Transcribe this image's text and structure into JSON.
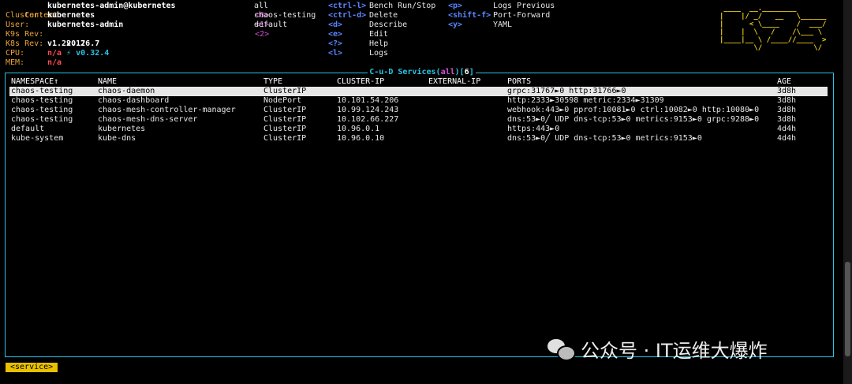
{
  "info": {
    "context_label": "Context:",
    "context_value": "kubernetes-admin@kubernetes",
    "cluster_label": "Cluster:",
    "cluster_value": "kubernetes",
    "user_label": "User:",
    "user_value": "kubernetes-admin",
    "k9s_rev_label": "K9s Rev:",
    "k9s_rev_value": "v0.26.7",
    "k9s_rev_new": "⚡ v0.32.4",
    "k8s_rev_label": "K8s Rev:",
    "k8s_rev_value": "v1.22.17",
    "cpu_label": "CPU:",
    "cpu_value": "n/a",
    "mem_label": "MEM:",
    "mem_value": "n/a"
  },
  "namespaces": [
    {
      "key": "<0>",
      "name": "all"
    },
    {
      "key": "<1>",
      "name": "chaos-testing"
    },
    {
      "key": "<2>",
      "name": "default"
    }
  ],
  "shortcuts_col1": [
    {
      "key": "<ctrl-l>",
      "action": "Bench Run/Stop"
    },
    {
      "key": "<ctrl-d>",
      "action": "Delete"
    },
    {
      "key": "<d>",
      "action": "Describe"
    },
    {
      "key": "<e>",
      "action": "Edit"
    },
    {
      "key": "<?>",
      "action": "Help"
    },
    {
      "key": "<l>",
      "action": "Logs"
    }
  ],
  "shortcuts_col2": [
    {
      "key": "<p>",
      "action": "Logs Previous"
    },
    {
      "key": "<shift-f>",
      "action": "Port-Forward"
    },
    {
      "key": "<y>",
      "action": "YAML"
    }
  ],
  "logo_lines": [
    " ____  __.________       ",
    "|    |/ _/   __   \\______",
    "|      < \\____    /  ___/",
    "|    |  \\   /    /\\___ \\ ",
    "|____|__ \\ /____//____  >",
    "        \\/            \\/ "
  ],
  "panel": {
    "title_prefix": " C-u-D Services(",
    "title_filter": "all",
    "title_mid": ")[",
    "title_count": "6",
    "title_suffix": "] "
  },
  "table": {
    "headers": [
      "NAMESPACE↑",
      "NAME",
      "TYPE",
      "CLUSTER-IP",
      "EXTERNAL-IP",
      "PORTS",
      "AGE"
    ],
    "rows": [
      [
        "chaos-testing",
        "chaos-daemon",
        "ClusterIP",
        "",
        "",
        "grpc:31767►0 http:31766►0",
        "3d8h"
      ],
      [
        "chaos-testing",
        "chaos-dashboard",
        "NodePort",
        "10.101.54.206",
        "",
        "http:2333►30598 metric:2334►31309",
        "3d8h"
      ],
      [
        "chaos-testing",
        "chaos-mesh-controller-manager",
        "ClusterIP",
        "10.99.124.243",
        "",
        "webhook:443►0 pprof:10081►0 ctrl:10082►0 http:10080►0",
        "3d8h"
      ],
      [
        "chaos-testing",
        "chaos-mesh-dns-server",
        "ClusterIP",
        "10.102.66.227",
        "",
        "dns:53►0╱ UDP dns-tcp:53►0 metrics:9153►0 grpc:9288►0",
        "3d8h"
      ],
      [
        "default",
        "kubernetes",
        "ClusterIP",
        "10.96.0.1",
        "",
        "https:443►0",
        "4d4h"
      ],
      [
        "kube-system",
        "kube-dns",
        "ClusterIP",
        "10.96.0.10",
        "",
        "dns:53►0╱ UDP dns-tcp:53►0 metrics:9153►0",
        "4d4h"
      ]
    ]
  },
  "breadcrumb": "<service>",
  "watermark": "公众号 · IT运维大爆炸"
}
